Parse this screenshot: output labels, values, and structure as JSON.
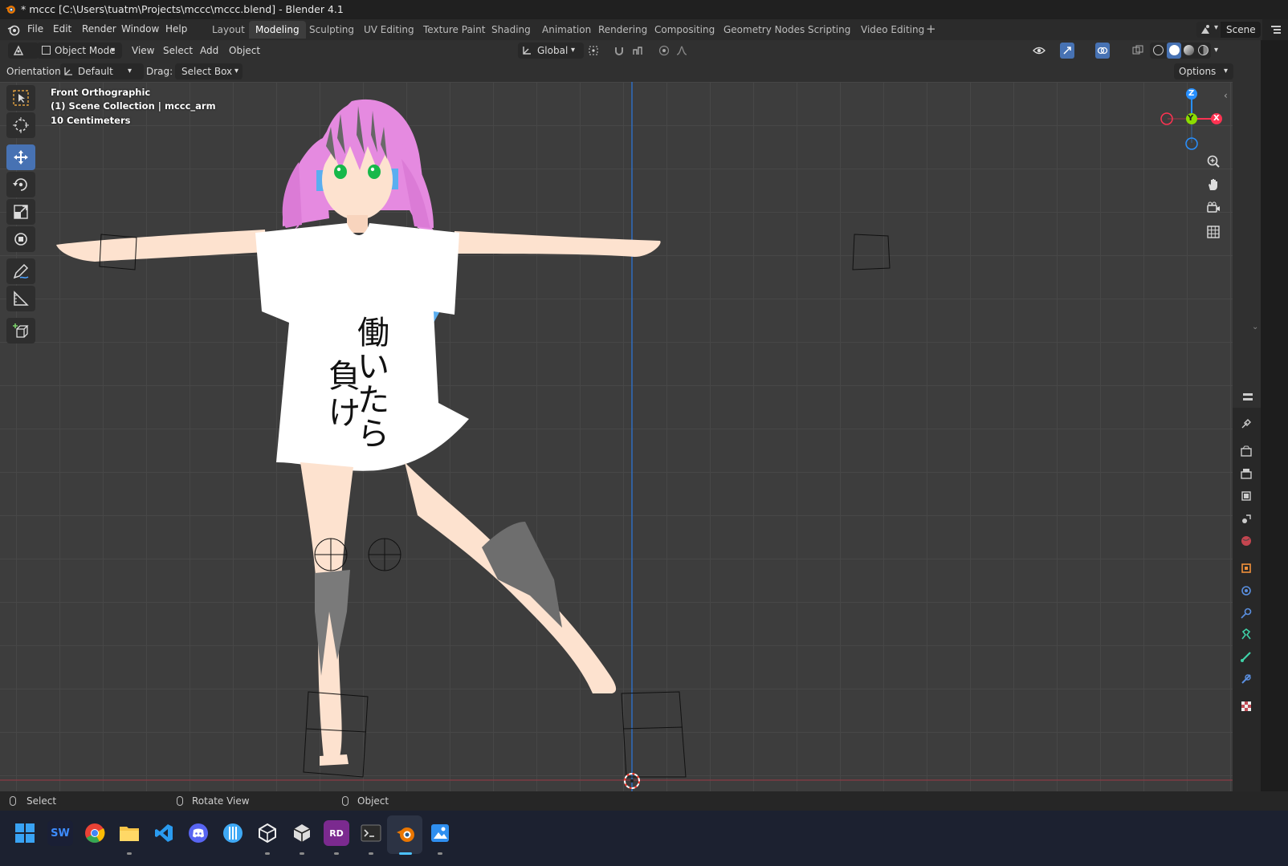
{
  "window": {
    "title": "* mccc [C:\\Users\\tuatm\\Projects\\mccc\\mccc.blend] - Blender 4.1"
  },
  "menu": [
    "File",
    "Edit",
    "Render",
    "Window",
    "Help"
  ],
  "workspaces": [
    {
      "label": "Layout",
      "active": false
    },
    {
      "label": "Modeling",
      "active": true
    },
    {
      "label": "Sculpting",
      "active": false
    },
    {
      "label": "UV Editing",
      "active": false
    },
    {
      "label": "Texture Paint",
      "active": false
    },
    {
      "label": "Shading",
      "active": false
    },
    {
      "label": "Animation",
      "active": false
    },
    {
      "label": "Rendering",
      "active": false
    },
    {
      "label": "Compositing",
      "active": false
    },
    {
      "label": "Geometry Nodes",
      "active": false
    },
    {
      "label": "Scripting",
      "active": false
    },
    {
      "label": "Video Editing",
      "active": false
    }
  ],
  "add_workspace": "+",
  "scene": {
    "label": "Scene"
  },
  "header": {
    "mode": "Object Mode",
    "menus": [
      "View",
      "Select",
      "Add",
      "Object"
    ],
    "transform_orientation": "Global"
  },
  "tool_settings": {
    "orientation_label": "Orientation:",
    "orientation_value": "Default",
    "drag_label": "Drag:",
    "drag_value": "Select Box",
    "options": "Options"
  },
  "viewport": {
    "view_name": "Front Orthographic",
    "collection": "(1) Scene Collection | mccc_arm",
    "scale": "10 Centimeters",
    "shirt_text": [
      "働",
      "い",
      "た",
      "ら",
      "負",
      "け"
    ]
  },
  "gizmo": {
    "z": "Z",
    "y": "Y",
    "x": "X"
  },
  "status": {
    "select": "Select",
    "rotate": "Rotate View",
    "object": "Object"
  },
  "taskbar": {
    "apps": [
      "start",
      "sw",
      "chrome",
      "explorer",
      "vscode",
      "discord",
      "app-blue",
      "unity",
      "unity-hub",
      "renderdoc",
      "terminal",
      "blender",
      "paint"
    ],
    "sw_label": "SW",
    "rd_label": "RD"
  },
  "colors": {
    "accent": "#4772b3",
    "x_axis": "#ff3352",
    "y_axis": "#8bdc00",
    "z_axis": "#2890ff",
    "viewport_bg": "#3d3d3d"
  }
}
